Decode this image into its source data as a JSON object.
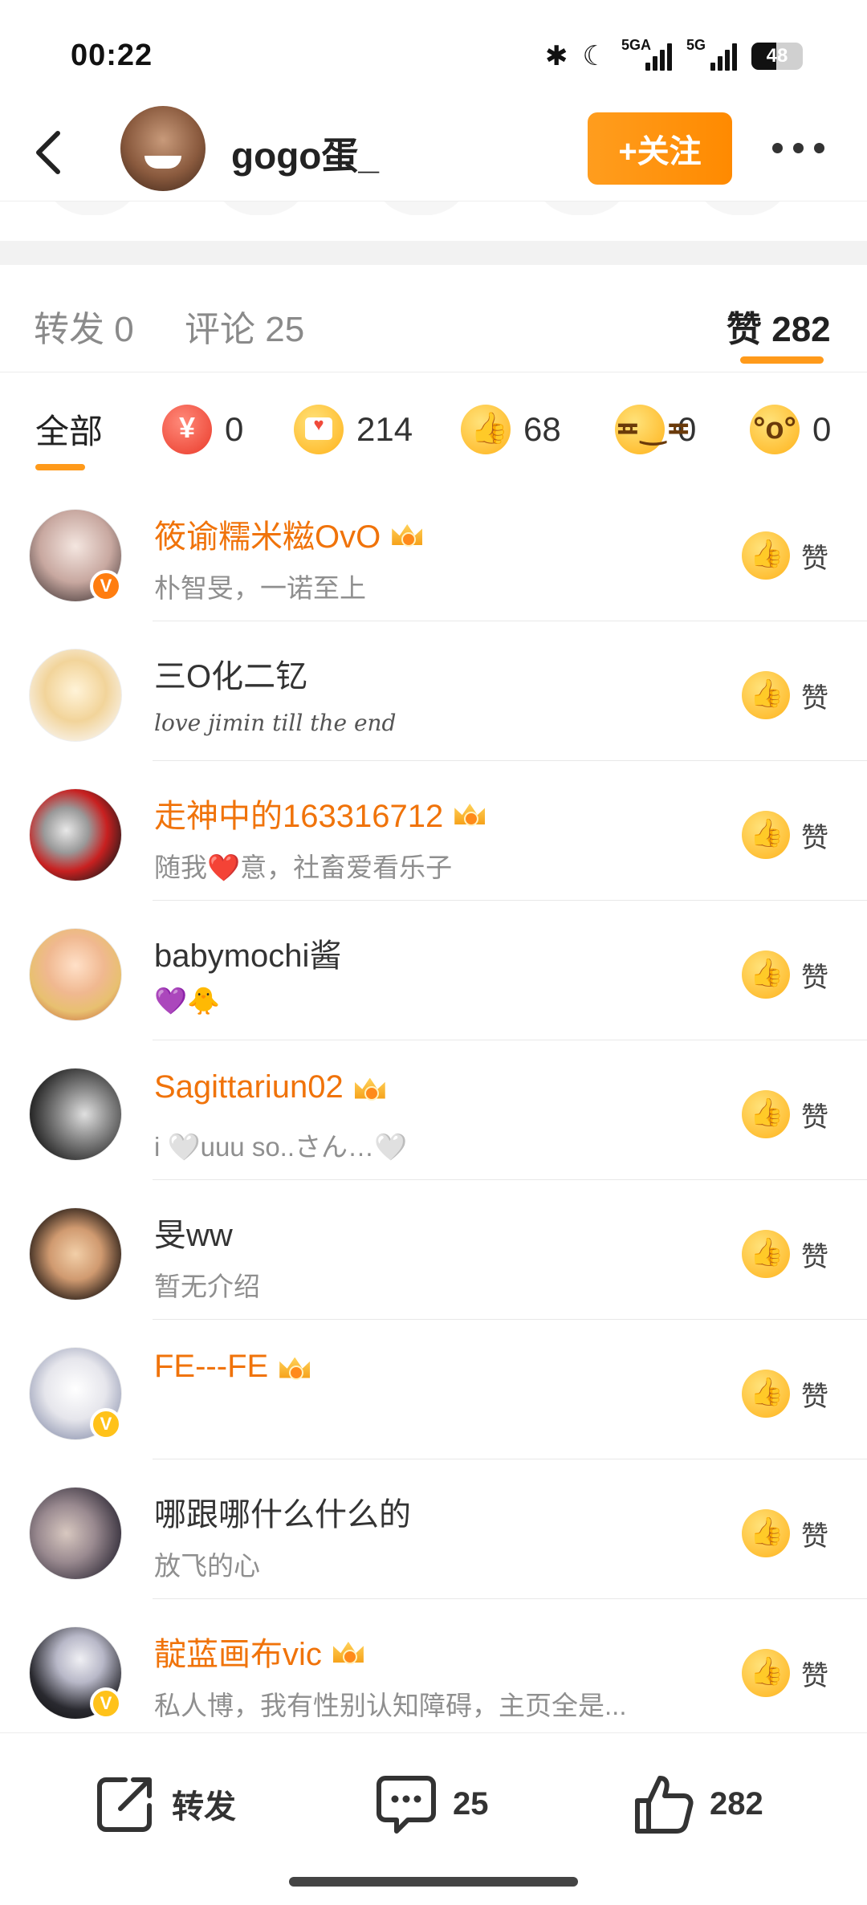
{
  "status_bar": {
    "time": "00:22",
    "battery": "48",
    "battery_level": 0.48,
    "signal1_label": "5GA",
    "signal2_label": "5G"
  },
  "header": {
    "username": "gogo蛋_",
    "follow_label": "+关注"
  },
  "tabs": {
    "repost": "转发 0",
    "comment": "评论 25",
    "like": "赞 282"
  },
  "filters": {
    "all": "全部",
    "reward_count": "0",
    "heart_count": "214",
    "thumb_count": "68",
    "laugh_count": "0",
    "surprise_count": "0"
  },
  "like_label": "赞",
  "users": [
    {
      "name": "筱谕糯米糍OvO",
      "bio": "朴智旻，一诺至上",
      "vip": true,
      "badge": "orange"
    },
    {
      "name": "三O化二钇",
      "bio": "love jimin till the end",
      "vip": false,
      "badge": ""
    },
    {
      "name": "走神中的163316712",
      "bio": "随我❤️意，社畜爱看乐子",
      "vip": true,
      "badge": ""
    },
    {
      "name": "babymochi酱",
      "bio": "💜🐥",
      "vip": false,
      "badge": ""
    },
    {
      "name": "Sagittariun02",
      "bio": "i 🤍uuu so..さん…🤍",
      "vip": true,
      "badge": ""
    },
    {
      "name": "旻ww",
      "bio": "暂无介绍",
      "vip": false,
      "badge": ""
    },
    {
      "name": "FE---FE",
      "bio": "",
      "vip": true,
      "badge": "gold"
    },
    {
      "name": "哪跟哪什么什么的",
      "bio": "放飞的心",
      "vip": false,
      "badge": ""
    },
    {
      "name": "靛蓝画布vic",
      "bio": "私人博，我有性别认知障碍，主页全是...",
      "vip": true,
      "badge": "gold"
    }
  ],
  "bottom_bar": {
    "repost": "转发",
    "comment": "25",
    "like": "282"
  },
  "colors": {
    "accent": "#ff8a00",
    "vip_name": "#f0730a"
  }
}
